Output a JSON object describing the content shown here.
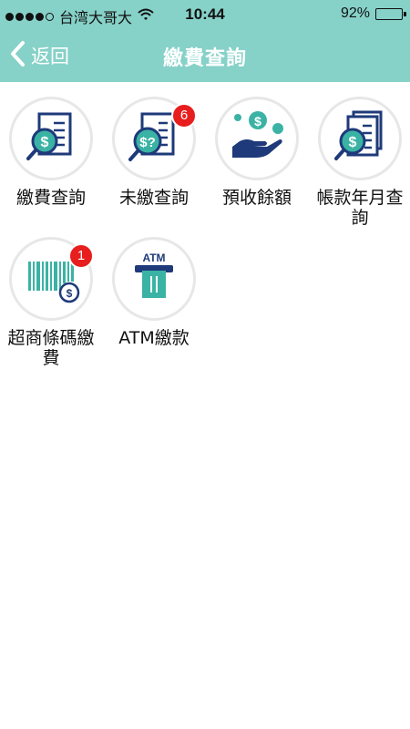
{
  "status_bar": {
    "carrier": "台湾大哥大",
    "time": "10:44",
    "battery": "92%",
    "battery_level": 0.92,
    "signal_bars_filled": 4,
    "signal_bars_total": 5
  },
  "nav": {
    "back_label": "返回",
    "title": "繳費查詢"
  },
  "colors": {
    "header": "#86d1c8",
    "icon_teal": "#3bb3a4",
    "icon_navy": "#1e3a7a",
    "badge": "#e81d1d"
  },
  "menu": [
    {
      "label": "繳費查詢",
      "icon": "bill-search-icon",
      "badge": ""
    },
    {
      "label": "未繳查詢",
      "icon": "unpaid-search-icon",
      "badge": "6"
    },
    {
      "label": "預收餘額",
      "icon": "hand-coins-icon",
      "badge": ""
    },
    {
      "label": "帳款年月查詢",
      "icon": "monthly-bill-search-icon",
      "badge": ""
    },
    {
      "label": "超商條碼繳費",
      "icon": "barcode-icon",
      "badge": "1"
    },
    {
      "label": "ATM繳款",
      "icon": "atm-icon",
      "badge": ""
    }
  ],
  "atm_text": "ATM"
}
